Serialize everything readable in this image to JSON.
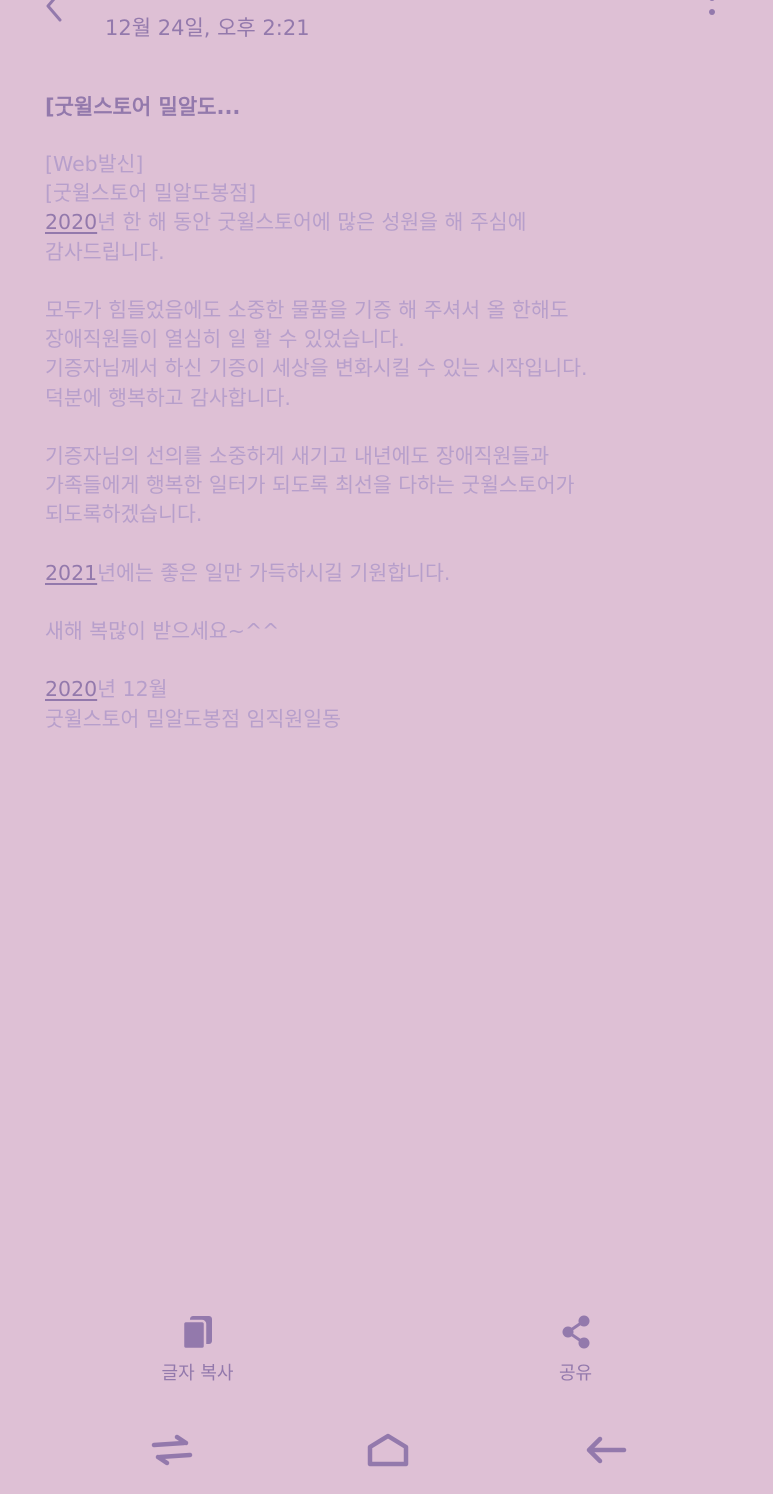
{
  "header": {
    "date": "12월 24일, 오후 2:21",
    "back_icon": "chevron-left-icon",
    "more_icon": "more-vertical-icon"
  },
  "message": {
    "title": "[굿윌스토어 밀알도...",
    "lines": {
      "l1": "[Web발신]",
      "l2": "[굿윌스토어 밀알도봉점]",
      "l3_link": "2020",
      "l3_rest": "년 한 해 동안 굿윌스토어에 많은 성원을 해 주심에",
      "l4": "감사드립니다.",
      "l5": "모두가 힘들었음에도 소중한 물품을 기증 해 주셔서 올 한해도",
      "l6": "장애직원들이 열심히 일 할 수 있었습니다.",
      "l7": "기증자님께서 하신 기증이 세상을 변화시킬 수 있는 시작입니다.",
      "l8": "덕분에 행복하고 감사합니다.",
      "l9": "기증자님의 선의를 소중하게 새기고 내년에도 장애직원들과",
      "l10": "가족들에게 행복한 일터가 되도록 최선을 다하는 굿윌스토어가",
      "l11": "되도록하겠습니다.",
      "l12_link": "2021",
      "l12_rest": "년에는 좋은 일만 가득하시길 기원합니다.",
      "l13": "새해 복많이 받으세요~^^",
      "l14_link": "2020",
      "l14_rest": "년 12월",
      "l15": "굿윌스토어 밀알도봉점 임직원일동"
    }
  },
  "actions": {
    "copy_label": "글자 복사",
    "share_label": "공유"
  },
  "nav": {
    "recents_icon": "recents-icon",
    "home_icon": "home-icon",
    "back_icon": "back-arrow-icon"
  },
  "colors": {
    "background": "#dec0d5",
    "text_strong": "#9379ac",
    "text_muted": "#b79fcb"
  }
}
